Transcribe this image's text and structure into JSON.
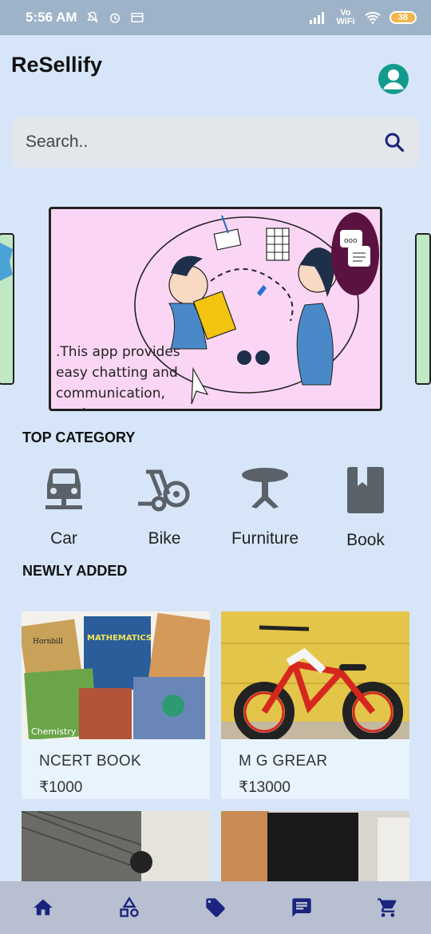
{
  "status_bar": {
    "time": "5:56 AM",
    "network": "Vo WiFi",
    "battery": "38"
  },
  "app": {
    "title": "ReSellify"
  },
  "search": {
    "placeholder": "Search.."
  },
  "banner": {
    "text": ".This app provides easy chatting and communication, made easy."
  },
  "top_category": {
    "heading": "TOP CATEGORY",
    "items": [
      {
        "label": "Car",
        "icon": "car-icon"
      },
      {
        "label": "Bike",
        "icon": "bike-icon"
      },
      {
        "label": "Furniture",
        "icon": "table-icon"
      },
      {
        "label": "Book",
        "icon": "book-icon"
      }
    ]
  },
  "newly_added": {
    "heading": "NEWLY ADDED",
    "items": [
      {
        "name": "NCERT BOOK",
        "price": "₹1000"
      },
      {
        "name": "M G GREAR",
        "price": "₹13000"
      }
    ]
  },
  "bottom_nav": [
    "home-icon",
    "category-icon",
    "tag-icon",
    "chat-icon",
    "cart-icon"
  ],
  "colors": {
    "accent": "#1a237e",
    "icon_gray": "#5b6168",
    "avatar": "#129b8d"
  }
}
